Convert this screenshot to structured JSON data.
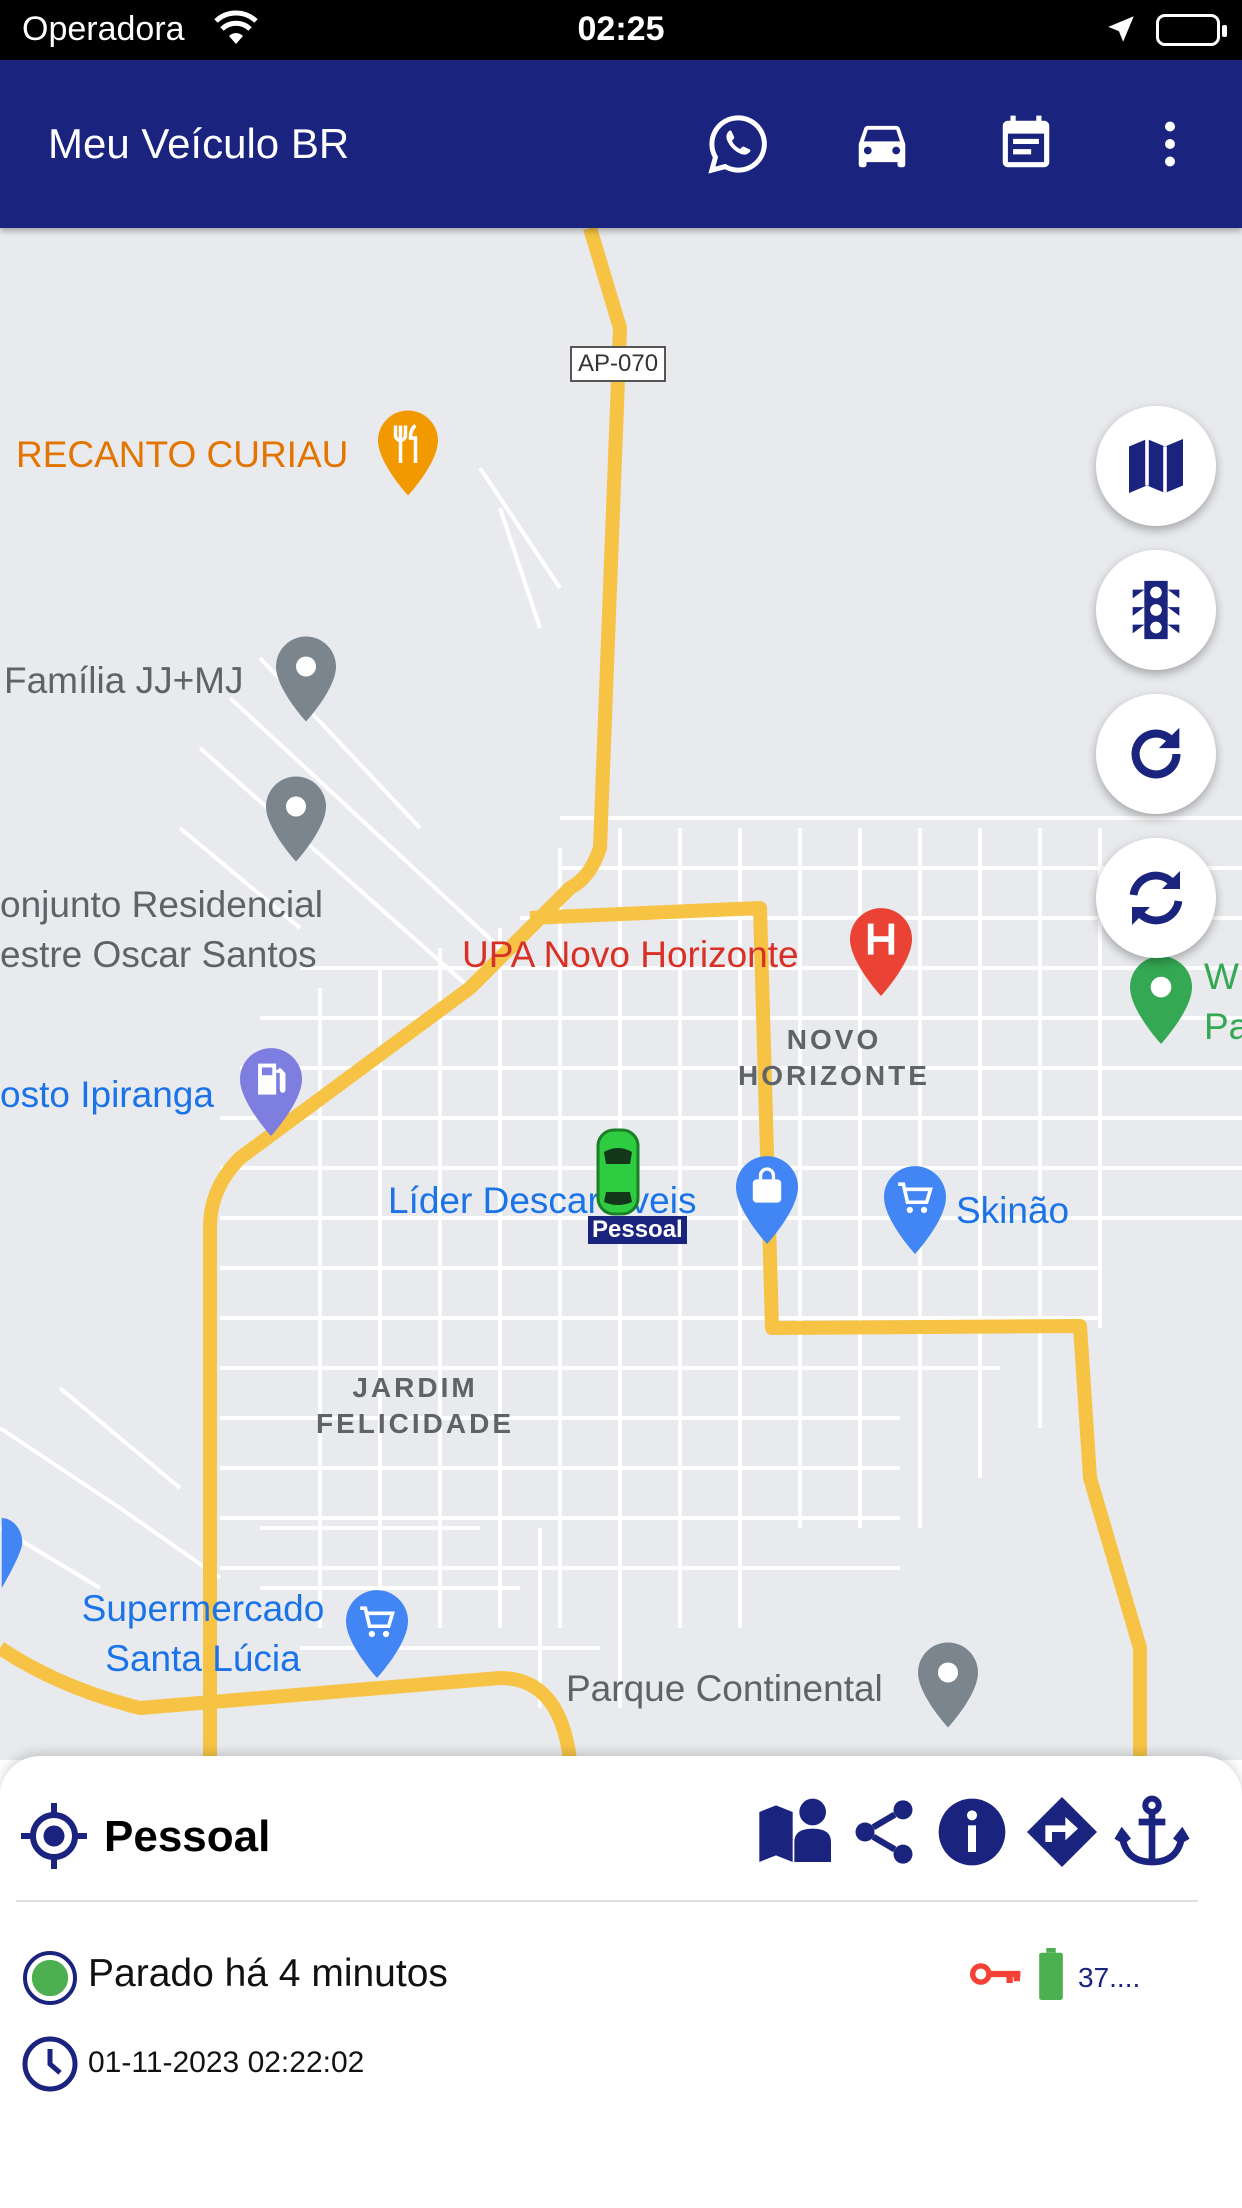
{
  "status_bar": {
    "carrier": "Operadora",
    "time": "02:25"
  },
  "app_bar": {
    "title": "Meu Veículo BR",
    "actions": [
      "whatsapp-icon",
      "car-icon",
      "report-icon",
      "more-vert-icon"
    ]
  },
  "map": {
    "road_shield": "AP-070",
    "places": {
      "recanto": "RECANTO CURIAU",
      "familia": "Família JJ+MJ",
      "conjunto_1": "onjunto Residencial",
      "conjunto_2": "estre Oscar Santos",
      "upa": "UPA Novo Horizonte",
      "novo_horizonte_1": "NOVO",
      "novo_horizonte_2": "HORIZONTE",
      "posto": "osto Ipiranga",
      "lider": "Líder Descartáveis",
      "skinao": "Skinão",
      "jardim_1": "JARDIM",
      "jardim_2": "FELICIDADE",
      "supermercado_1": "Supermercado",
      "supermercado_2": "Santa Lúcia",
      "parque": "Parque Continental",
      "edge_w": "W",
      "edge_pa": "Pa"
    },
    "vehicle_marker_label": "Pessoal",
    "fabs": [
      "map-layers-icon",
      "traffic-icon",
      "refresh-icon",
      "sync-icon"
    ],
    "colors": {
      "road": "#f6c344",
      "background": "#e8eaed"
    }
  },
  "panel": {
    "vehicle_name": "Pessoal",
    "actions": [
      "person-pin-map-icon",
      "share-icon",
      "info-icon",
      "directions-icon",
      "anchor-icon"
    ],
    "status_text": "Parado há 4 minutos",
    "datetime": "01-11-2023 02:22:02",
    "voltage": "37....",
    "colors": {
      "primary": "#1a237e",
      "status_ok": "#4caf50",
      "key": "#f44336"
    }
  }
}
